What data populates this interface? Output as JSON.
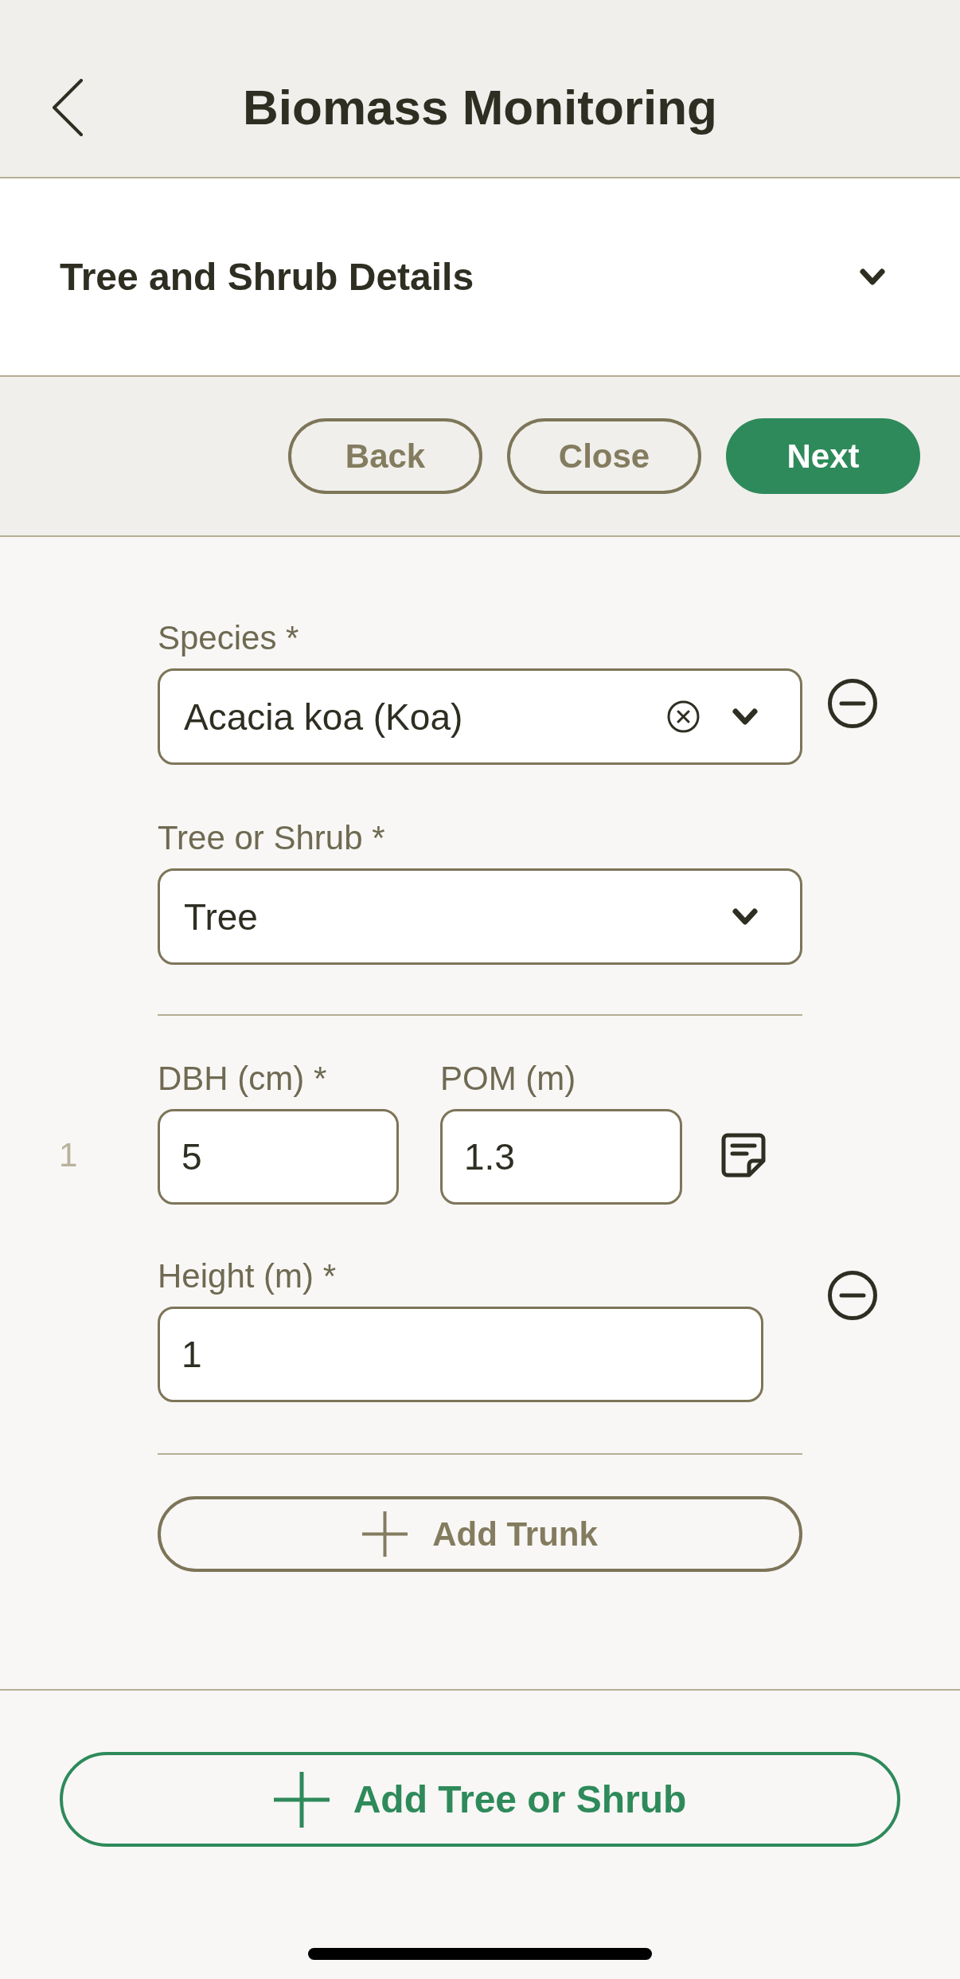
{
  "header": {
    "title": "Biomass Monitoring"
  },
  "section": {
    "title": "Tree and Shrub Details"
  },
  "nav_buttons": [
    {
      "label": "Back",
      "kind": "secondary"
    },
    {
      "label": "Close",
      "kind": "secondary"
    },
    {
      "label": "Next",
      "kind": "primary"
    }
  ],
  "plants": [
    {
      "species": {
        "label": "Species *",
        "value": "Acacia koa (Koa)"
      },
      "growth_form": {
        "label": "Tree or Shrub *",
        "value": "Tree"
      },
      "trunks": [
        {
          "number": "1",
          "dbh": {
            "label": "DBH (cm) *",
            "value": "5"
          },
          "pom": {
            "label": "POM (m)",
            "value": "1.3"
          },
          "height": {
            "label": "Height (m) *",
            "value": "1"
          }
        }
      ],
      "add_trunk_button": "Add Trunk"
    }
  ],
  "add_plant_button": "Add Tree or Shrub"
}
